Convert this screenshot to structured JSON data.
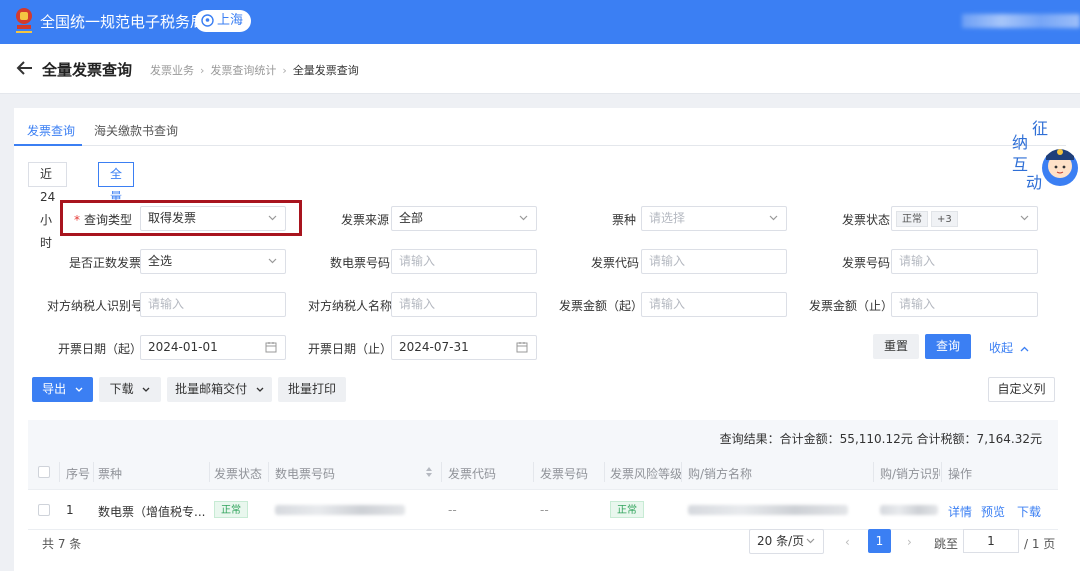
{
  "header": {
    "app_title": "全国统一规范电子税务局",
    "location": "上海"
  },
  "breadcrumb_bar": {
    "page_title": "全量发票查询",
    "crumbs": [
      "发票业务",
      "发票查询统计",
      "全量发票查询"
    ]
  },
  "tabs": [
    "发票查询",
    "海关缴款书查询"
  ],
  "time_range": [
    "近24小时",
    "全量"
  ],
  "filters": {
    "query_type": {
      "label": "查询类型",
      "value": "取得发票"
    },
    "invoice_source": {
      "label": "发票来源",
      "value": "全部"
    },
    "ticket_type": {
      "label": "票种",
      "placeholder": "请选择"
    },
    "invoice_status": {
      "label": "发票状态",
      "tags": [
        "正常",
        "+3"
      ]
    },
    "is_positive": {
      "label": "是否正数发票",
      "value": "全选"
    },
    "e_invoice_no": {
      "label": "数电票号码",
      "placeholder": "请输入"
    },
    "invoice_code": {
      "label": "发票代码",
      "placeholder": "请输入"
    },
    "invoice_no": {
      "label": "发票号码",
      "placeholder": "请输入"
    },
    "counterparty_id": {
      "label": "对方纳税人识别号",
      "placeholder": "请输入"
    },
    "counterparty_name": {
      "label": "对方纳税人名称",
      "placeholder": "请输入"
    },
    "amount_from": {
      "label": "发票金额（起）",
      "placeholder": "请输入"
    },
    "amount_to": {
      "label": "发票金额（止）",
      "placeholder": "请输入"
    },
    "date_from": {
      "label": "开票日期（起）",
      "value": "2024-01-01"
    },
    "date_to": {
      "label": "开票日期（止）",
      "value": "2024-07-31"
    }
  },
  "actions": {
    "reset": "重置",
    "search": "查询",
    "collapse": "收起",
    "export": "导出",
    "download": "下载",
    "batch_email": "批量邮箱交付",
    "batch_print": "批量打印",
    "custom_columns": "自定义列"
  },
  "result_summary": "查询结果：合计金额：55,110.12元   合计税额：7,164.32元",
  "table": {
    "columns": [
      "序号",
      "票种",
      "发票状态",
      "数电票号码",
      "发票代码",
      "发票号码",
      "发票风险等级",
      "购/销方名称",
      "购/销方识别",
      "操作"
    ],
    "rows": [
      {
        "index": "1",
        "ticket_type": "数电票（增值税专...",
        "status": "正常",
        "invoice_code": "--",
        "invoice_no": "--",
        "risk_level": "正常",
        "ops": [
          "详情",
          "预览",
          "下载"
        ]
      }
    ]
  },
  "pagination": {
    "total": "共 7 条",
    "page_size": "20 条/页",
    "current_page": "1",
    "jump_label": "跳至",
    "jump_value": "1",
    "page_total": "/ 1 页",
    "prev": "‹",
    "next": "›"
  },
  "mascot_text": [
    "征",
    "纳",
    "互",
    "动"
  ],
  "colors": {
    "primary": "#3b7ff3",
    "highlight": "#a8141e",
    "success": "#2fa35b"
  }
}
